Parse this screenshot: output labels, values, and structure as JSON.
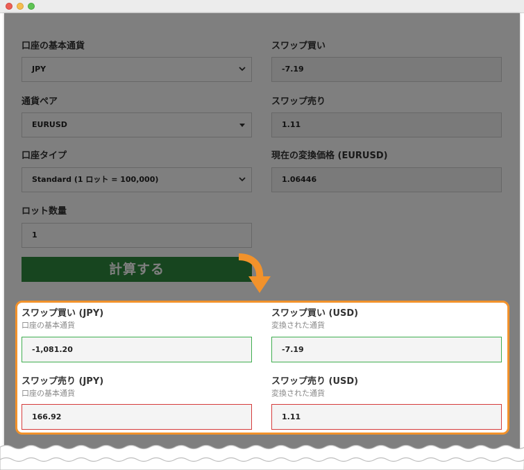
{
  "window": {
    "traffic_lights": [
      "close",
      "minimize",
      "zoom"
    ]
  },
  "form": {
    "base_currency": {
      "label": "口座の基本通貨",
      "value": "JPY"
    },
    "pair": {
      "label": "通貨ペア",
      "value": "EURUSD"
    },
    "account_type": {
      "label": "口座タイプ",
      "value": "Standard (1 ロット = 100,000)"
    },
    "lots": {
      "label": "ロット数量",
      "value": "1"
    },
    "swap_buy": {
      "label": "スワップ買い",
      "value": "-7.19"
    },
    "swap_sell": {
      "label": "スワップ売り",
      "value": "1.11"
    },
    "rate": {
      "label": "現在の変換価格 (EURUSD)",
      "value": "1.06446"
    },
    "calculate_label": "計算する"
  },
  "results": {
    "buy_jpy": {
      "title": "スワップ買い (JPY)",
      "sub": "口座の基本通貨",
      "value": "-1,081.20"
    },
    "buy_usd": {
      "title": "スワップ買い (USD)",
      "sub": "変換された通貨",
      "value": "-7.19"
    },
    "sell_jpy": {
      "title": "スワップ売り (JPY)",
      "sub": "口座の基本通貨",
      "value": "166.92"
    },
    "sell_usd": {
      "title": "スワップ売り (USD)",
      "sub": "変換された通貨",
      "value": "1.11"
    }
  },
  "colors": {
    "accent_orange": "#f2922b",
    "button_green": "#2e8b3e",
    "positive_border": "#3fae4f",
    "negative_border": "#d53a3a",
    "overlay": "rgba(0,0,0,0.5)"
  },
  "icons": [
    "chevron-down-icon",
    "caret-down-icon",
    "curved-arrow-icon"
  ]
}
